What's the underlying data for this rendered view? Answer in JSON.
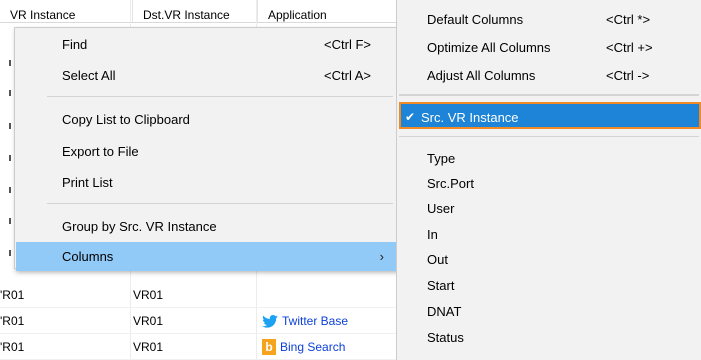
{
  "table": {
    "headers": [
      "VR Instance",
      "Dst.VR Instance",
      "Application"
    ],
    "rows": [
      {
        "src": "'R01",
        "dst": "VR01",
        "app": ""
      },
      {
        "src": "'R01",
        "dst": "VR01",
        "app": "Twitter Base",
        "app_icon": "twitter-icon"
      },
      {
        "src": "'R01",
        "dst": "VR01",
        "app": "Bing Search",
        "app_icon": "bing-icon"
      }
    ]
  },
  "context_menu": {
    "items": [
      {
        "label": "Find",
        "shortcut": "<Ctrl F>"
      },
      {
        "label": "Select All",
        "shortcut": "<Ctrl A>"
      },
      {
        "label": "Copy List to Clipboard"
      },
      {
        "label": "Export to File"
      },
      {
        "label": "Print List"
      },
      {
        "label": "Group by Src. VR Instance"
      },
      {
        "label": "Columns",
        "submenu_arrow": "›",
        "highlighted": true
      }
    ]
  },
  "columns_submenu": {
    "top_items": [
      {
        "label": "Default Columns",
        "shortcut": "<Ctrl *>"
      },
      {
        "label": "Optimize All Columns",
        "shortcut": "<Ctrl +>"
      },
      {
        "label": "Adjust All Columns",
        "shortcut": "<Ctrl ->"
      }
    ],
    "checked_item": {
      "label": "Src. VR Instance",
      "check": "✔"
    },
    "column_items": [
      "Type",
      "Src.Port",
      "User",
      "In",
      "Out",
      "Start",
      "DNAT",
      "Status"
    ]
  },
  "colors": {
    "menu_bg": "#f2f2f2",
    "highlight": "#91c9f7",
    "selected": "#1e84d7",
    "selected_border": "#f08a24",
    "link": "#0b3fd6"
  }
}
